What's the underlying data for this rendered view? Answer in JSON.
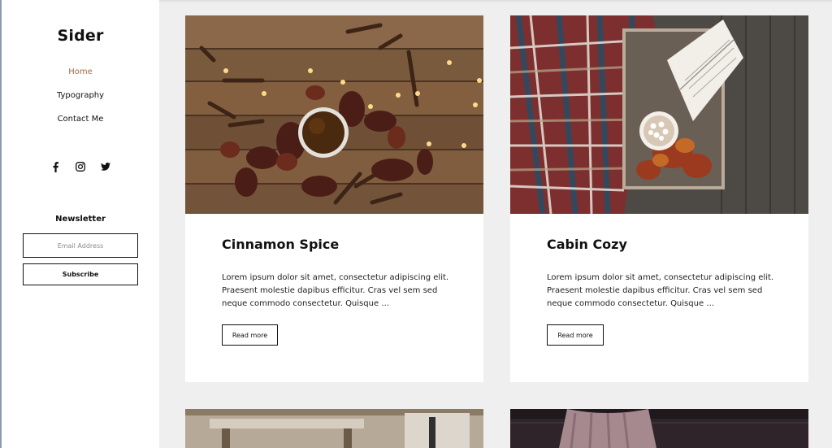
{
  "sidebar": {
    "brand": "Sider",
    "nav": [
      {
        "label": "Home",
        "active": true
      },
      {
        "label": "Typography",
        "active": false
      },
      {
        "label": "Contact Me",
        "active": false
      }
    ],
    "social": [
      "facebook-icon",
      "instagram-icon",
      "twitter-icon"
    ],
    "newsletter": {
      "title": "Newsletter",
      "email_placeholder": "Email Address",
      "subscribe_label": "Subscribe"
    }
  },
  "posts": [
    {
      "title": "Cinnamon Spice",
      "excerpt": "Lorem ipsum dolor sit amet, consectetur adipiscing elit. Praesent molestie dapibus efficitur. Cras vel sem sed neque commodo consectetur. Quisque …",
      "button": "Read more"
    },
    {
      "title": "Cabin Cozy",
      "excerpt": "Lorem ipsum dolor sit amet, consectetur adipiscing elit. Praesent molestie dapibus efficitur. Cras vel sem sed neque commodo consectetur. Quisque …",
      "button": "Read more"
    }
  ],
  "colors": {
    "accent": "#a8653c",
    "page_background": "#efefef",
    "card_background": "#ffffff",
    "text": "#111111"
  }
}
